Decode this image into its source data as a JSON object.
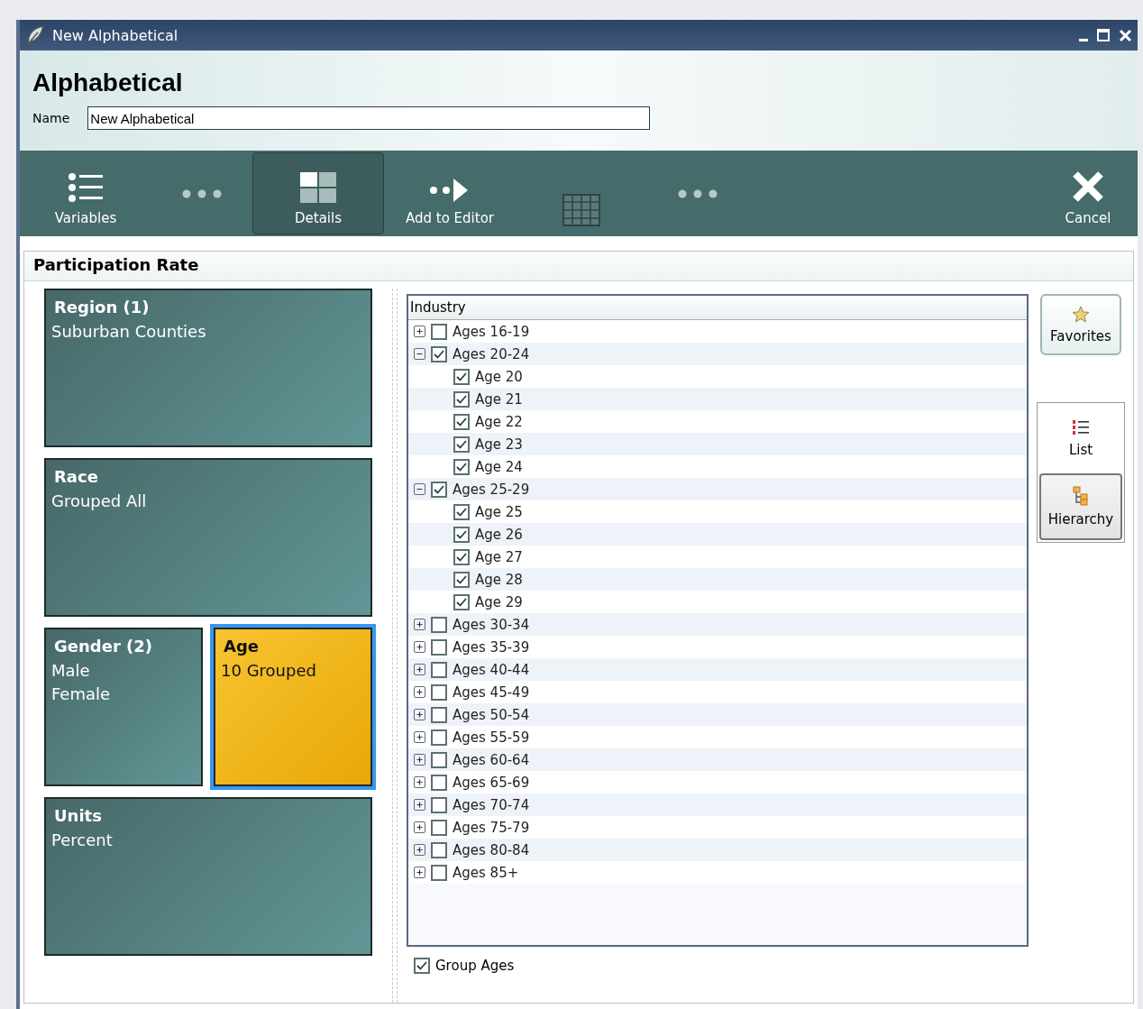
{
  "window": {
    "title": "New Alphabetical"
  },
  "header": {
    "title": "Alphabetical",
    "name_label": "Name",
    "name_value": "New Alphabetical"
  },
  "toolbar": [
    {
      "kind": "list",
      "label": "Variables",
      "selected": false
    },
    {
      "kind": "dots",
      "selected": false
    },
    {
      "kind": "tiles",
      "label": "Details",
      "selected": true
    },
    {
      "kind": "arrow",
      "label": "Add to Editor",
      "selected": false
    },
    {
      "kind": "grid",
      "selected": false
    },
    {
      "kind": "dots",
      "selected": false
    },
    {
      "kind": "close",
      "label": "Cancel",
      "selected": false
    }
  ],
  "panel": {
    "title": "Participation Rate"
  },
  "tiles": [
    {
      "kind": "wide",
      "title": "Region (1)",
      "lines": [
        "Suburban Counties"
      ],
      "selected": false
    },
    {
      "kind": "wide",
      "title": "Race",
      "lines": [
        "Grouped All"
      ],
      "selected": false
    },
    {
      "kind": "half",
      "title": "Gender (2)",
      "lines": [
        "Male",
        "Female"
      ],
      "selected": false
    },
    {
      "kind": "half",
      "title": "Age",
      "lines": [
        "10 Grouped"
      ],
      "selected": true
    },
    {
      "kind": "wide",
      "title": "Units",
      "lines": [
        "Percent"
      ],
      "selected": false
    }
  ],
  "tree": {
    "header": "Industry",
    "items": [
      {
        "label": "Ages 16-19",
        "checked": false,
        "expanded": false
      },
      {
        "label": "Ages 20-24",
        "checked": true,
        "expanded": true,
        "children": [
          {
            "label": "Age 20",
            "checked": true
          },
          {
            "label": "Age 21",
            "checked": true
          },
          {
            "label": "Age 22",
            "checked": true
          },
          {
            "label": "Age 23",
            "checked": true
          },
          {
            "label": "Age 24",
            "checked": true
          }
        ]
      },
      {
        "label": "Ages 25-29",
        "checked": true,
        "expanded": true,
        "children": [
          {
            "label": "Age 25",
            "checked": true
          },
          {
            "label": "Age 26",
            "checked": true
          },
          {
            "label": "Age 27",
            "checked": true
          },
          {
            "label": "Age 28",
            "checked": true
          },
          {
            "label": "Age 29",
            "checked": true
          }
        ]
      },
      {
        "label": "Ages 30-34",
        "checked": false,
        "expanded": false
      },
      {
        "label": "Ages 35-39",
        "checked": false,
        "expanded": false
      },
      {
        "label": "Ages 40-44",
        "checked": false,
        "expanded": false
      },
      {
        "label": "Ages 45-49",
        "checked": false,
        "expanded": false
      },
      {
        "label": "Ages 50-54",
        "checked": false,
        "expanded": false
      },
      {
        "label": "Ages 55-59",
        "checked": false,
        "expanded": false
      },
      {
        "label": "Ages 60-64",
        "checked": false,
        "expanded": false
      },
      {
        "label": "Ages 65-69",
        "checked": false,
        "expanded": false
      },
      {
        "label": "Ages 70-74",
        "checked": false,
        "expanded": false
      },
      {
        "label": "Ages 75-79",
        "checked": false,
        "expanded": false
      },
      {
        "label": "Ages 80-84",
        "checked": false,
        "expanded": false
      },
      {
        "label": "Ages 85+",
        "checked": false,
        "expanded": false
      }
    ]
  },
  "group_ages": {
    "label": "Group Ages",
    "checked": true
  },
  "side": {
    "favorites": "Favorites",
    "views": [
      {
        "kind": "list",
        "label": "List",
        "selected": false
      },
      {
        "kind": "hierarchy",
        "label": "Hierarchy",
        "selected": true
      }
    ]
  }
}
